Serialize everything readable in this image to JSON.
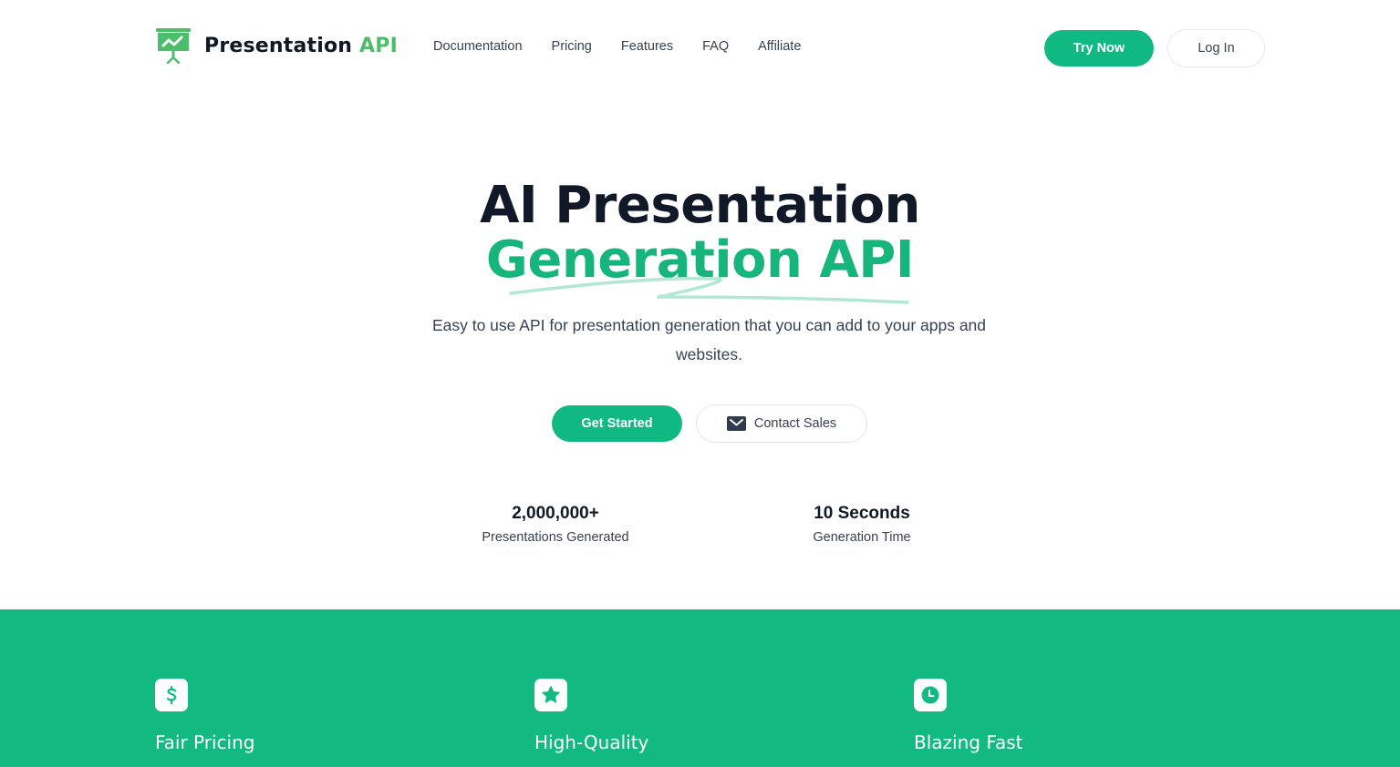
{
  "header": {
    "logo": {
      "text_main": "Presentation",
      "text_accent": "API",
      "icon": "presentation-chart-icon"
    },
    "nav": [
      {
        "label": "Documentation"
      },
      {
        "label": "Pricing"
      },
      {
        "label": "Features"
      },
      {
        "label": "FAQ"
      },
      {
        "label": "Affiliate"
      }
    ],
    "try_now_label": "Try Now",
    "login_label": "Log In"
  },
  "hero": {
    "title_line1": "AI Presentation",
    "title_line2": "Generation API",
    "subtitle": "Easy to use API for presentation generation that you can add to your apps and websites.",
    "get_started_label": "Get Started",
    "contact_sales_label": "Contact Sales",
    "contact_icon": "envelope-icon"
  },
  "stats": [
    {
      "value": "2,000,000+",
      "label": "Presentations Generated"
    },
    {
      "value": "10 Seconds",
      "label": "Generation Time"
    }
  ],
  "features": [
    {
      "title": "Fair Pricing",
      "icon": "dollar-icon"
    },
    {
      "title": "High-Quality",
      "icon": "star-icon"
    },
    {
      "title": "Blazing Fast",
      "icon": "clock-icon"
    }
  ],
  "colors": {
    "brand_green": "#10b981",
    "logo_green": "#4cbd6a",
    "heading_dark": "#111827",
    "band_green": "#12b981"
  }
}
